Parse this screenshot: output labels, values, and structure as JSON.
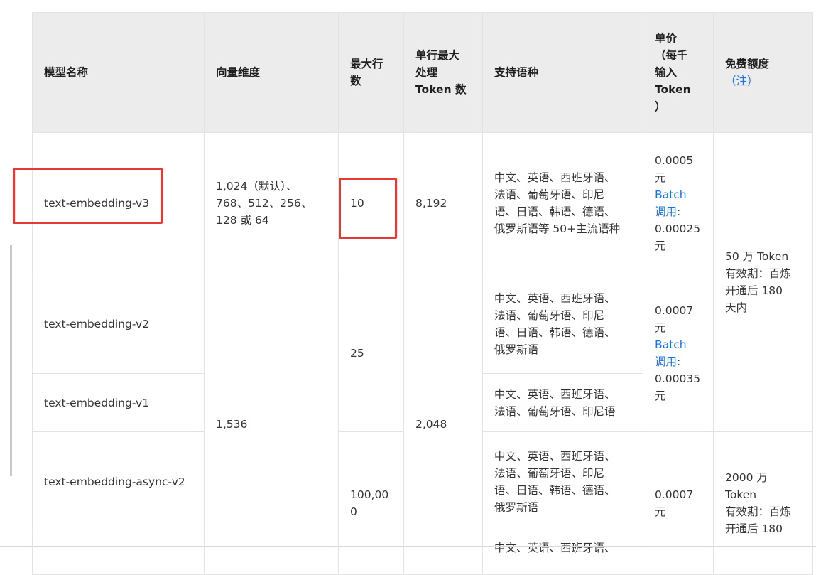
{
  "headers": {
    "model": "模型名称",
    "dim": "向量维度",
    "rows": "最大行\n数",
    "tokens": "单行最大\n处理\nToken 数",
    "lang": "支持语种",
    "price": "单价\n（每千\n输入\nToken\n）",
    "free": "免费额度",
    "free_note": "（注）"
  },
  "rows": {
    "v3": {
      "model": "text-embedding-v3",
      "dim": "1,024（默认）、\n768、512、256、\n128 或 64",
      "max_rows": "10",
      "max_tokens": "8,192",
      "lang": "中文、英语、西班牙语、\n法语、葡萄牙语、印尼\n语、日语、韩语、德语、\n俄罗斯语等 50+主流语种",
      "price_a": "0.0005\n元",
      "price_batch": "Batch\n调用",
      "price_b": ":\n0.00025\n元"
    },
    "v2": {
      "model": "text-embedding-v2",
      "lang": "中文、英语、西班牙语、\n法语、葡萄牙语、印尼\n语、日语、韩语、德语、\n俄罗斯语",
      "price_a": "0.0007\n元",
      "price_batch": "Batch\n调用",
      "price_b": ":\n0.00035\n元"
    },
    "v1": {
      "model": "text-embedding-v1",
      "lang": "中文、英语、西班牙语、\n法语、葡萄牙语、印尼语"
    },
    "async_v2": {
      "model": "text-embedding-async-v2",
      "lang": "中文、英语、西班牙语、\n法语、葡萄牙语、印尼\n语、日语、韩语、德语、\n俄罗斯语",
      "max_rows": "100,00\n0",
      "price": "0.0007\n元",
      "free": "2000 万\nToken\n有效期：百炼\n开通后 180"
    },
    "async_v1": {
      "lang": "中文、英语、西班牙语、"
    }
  },
  "merged": {
    "dim_1536": "1,536",
    "rows_25": "25",
    "tokens_2048": "2,048",
    "free_v3": "50 万 Token\n有效期：百炼\n开通后 180\n天内"
  }
}
